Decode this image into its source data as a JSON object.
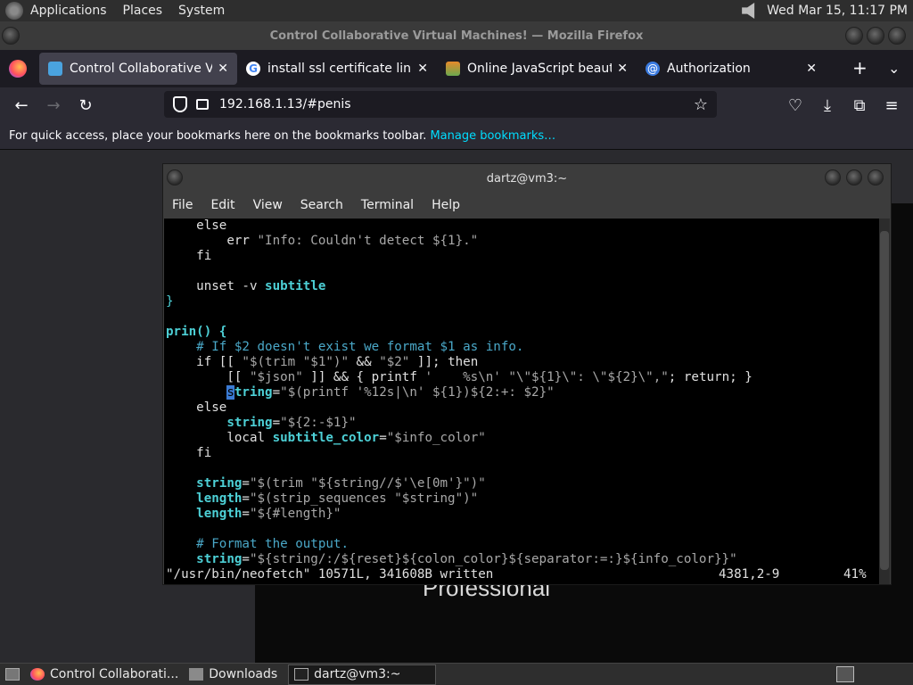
{
  "top_panel": {
    "menus": [
      "Applications",
      "Places",
      "System"
    ],
    "clock": "Wed Mar 15, 11:17 PM"
  },
  "firefox": {
    "window_title": "Control Collaborative Virtual Machines! — Mozilla Firefox",
    "tabs": [
      {
        "label": "Control Collaborative Virtual",
        "active": true
      },
      {
        "label": "install ssl certificate linux - G",
        "active": false
      },
      {
        "label": "Online JavaScript beautifier",
        "active": false
      },
      {
        "label": "Authorization",
        "active": false
      }
    ],
    "url": "192.168.1.13/#penis",
    "bookmarks_text": "For quick access, place your bookmarks here on the bookmarks toolbar.",
    "bookmarks_link": "Manage bookmarks…"
  },
  "page": {
    "behind_text": "Professional"
  },
  "terminal": {
    "title": "dartz@vm3:~",
    "menu": [
      "File",
      "Edit",
      "View",
      "Search",
      "Terminal",
      "Help"
    ],
    "status_left": "\"/usr/bin/neofetch\" 10571L, 341608B written",
    "status_pos": "4381,2-9",
    "status_pct": "41%"
  },
  "taskbar": {
    "items": [
      {
        "label": "Control Collaborati...",
        "active": false
      },
      {
        "label": "Downloads",
        "active": false
      },
      {
        "label": "dartz@vm3:~",
        "active": true
      }
    ]
  },
  "colors": {
    "terminal_bg": "#000000",
    "syntax_cyan": "#4dd0d6",
    "link": "#00ddff"
  }
}
